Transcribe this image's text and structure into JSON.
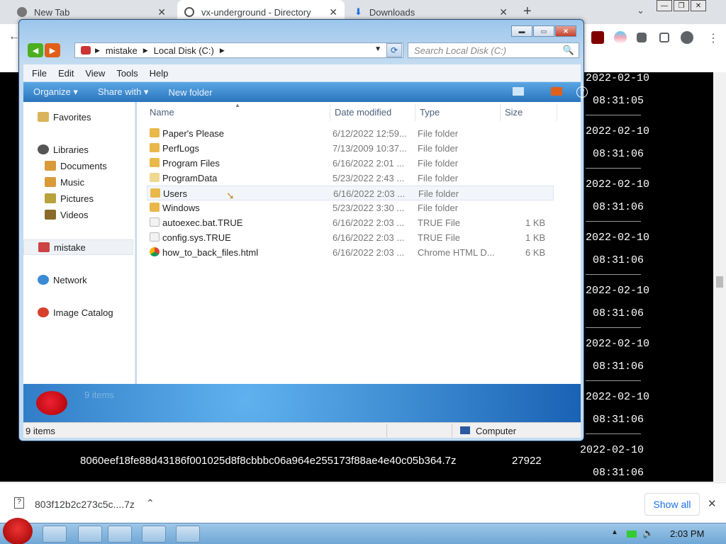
{
  "browser": {
    "tabs": [
      {
        "title": "New Tab",
        "active": false
      },
      {
        "title": "vx-underground - Directory",
        "active": true
      },
      {
        "title": "Downloads",
        "active": false
      }
    ],
    "new_tab": "+",
    "tab_close": "✕",
    "tab_menu": "⌄",
    "window_controls": {
      "min": "—",
      "max": "❐",
      "close": "✕"
    }
  },
  "content": {
    "entries": [
      {
        "date": "2022-02-10",
        "time": "08:31:05"
      },
      {
        "date": "2022-02-10",
        "time": "08:31:06"
      },
      {
        "date": "2022-02-10",
        "time": "08:31:06"
      },
      {
        "date": "2022-02-10",
        "time": "08:31:06"
      },
      {
        "date": "2022-02-10",
        "time": "08:31:06"
      },
      {
        "date": "2022-02-10",
        "time": "08:31:06"
      },
      {
        "date": "2022-02-10",
        "time": "08:31:06"
      },
      {
        "date": "2022-02-10",
        "time": "08:31:06"
      }
    ],
    "last_hash": "8060eef18fe88d43186f001025d8f8cbbbc06a964e255173f88ae4e40c05b364.7z",
    "last_size": "27922"
  },
  "download_bar": {
    "file": "803f12b2c273c5c....7z",
    "show_all": "Show all",
    "close": "✕"
  },
  "taskbar": {
    "clock": "2:03 PM"
  },
  "explorer": {
    "address": [
      "mistake",
      "Local Disk (C:)"
    ],
    "search_placeholder": "Search Local Disk (C:)",
    "menu": [
      "File",
      "Edit",
      "View",
      "Tools",
      "Help"
    ],
    "commands": {
      "organize": "Organize",
      "share": "Share with",
      "new_folder": "New folder"
    },
    "nav": {
      "favorites": "Favorites",
      "libraries": "Libraries",
      "documents": "Documents",
      "music": "Music",
      "pictures": "Pictures",
      "videos": "Videos",
      "user": "mistake",
      "network": "Network",
      "image_catalog": "Image Catalog"
    },
    "columns": {
      "name": "Name",
      "date": "Date modified",
      "type": "Type",
      "size": "Size"
    },
    "files": [
      {
        "name": "Paper's Please",
        "date": "6/12/2022 12:59...",
        "type": "File folder",
        "size": "",
        "kind": "folder"
      },
      {
        "name": "PerfLogs",
        "date": "7/13/2009 10:37...",
        "type": "File folder",
        "size": "",
        "kind": "folder"
      },
      {
        "name": "Program Files",
        "date": "6/16/2022 2:01 ...",
        "type": "File folder",
        "size": "",
        "kind": "folder"
      },
      {
        "name": "ProgramData",
        "date": "5/23/2022 2:43 ...",
        "type": "File folder",
        "size": "",
        "kind": "folder"
      },
      {
        "name": "Users",
        "date": "6/16/2022 2:03 ...",
        "type": "File folder",
        "size": "",
        "kind": "folder"
      },
      {
        "name": "Windows",
        "date": "5/23/2022 3:30 ...",
        "type": "File folder",
        "size": "",
        "kind": "folder"
      },
      {
        "name": "autoexec.bat.TRUE",
        "date": "6/16/2022 2:03 ...",
        "type": "TRUE File",
        "size": "1 KB",
        "kind": "file"
      },
      {
        "name": "config.sys.TRUE",
        "date": "6/16/2022 2:03 ...",
        "type": "TRUE File",
        "size": "1 KB",
        "kind": "file"
      },
      {
        "name": "how_to_back_files.html",
        "date": "6/16/2022 2:03 ...",
        "type": "Chrome HTML D...",
        "size": "6 KB",
        "kind": "chrome"
      }
    ],
    "banner_count": "9 items",
    "status_count": "9 items",
    "status_location": "Computer"
  }
}
